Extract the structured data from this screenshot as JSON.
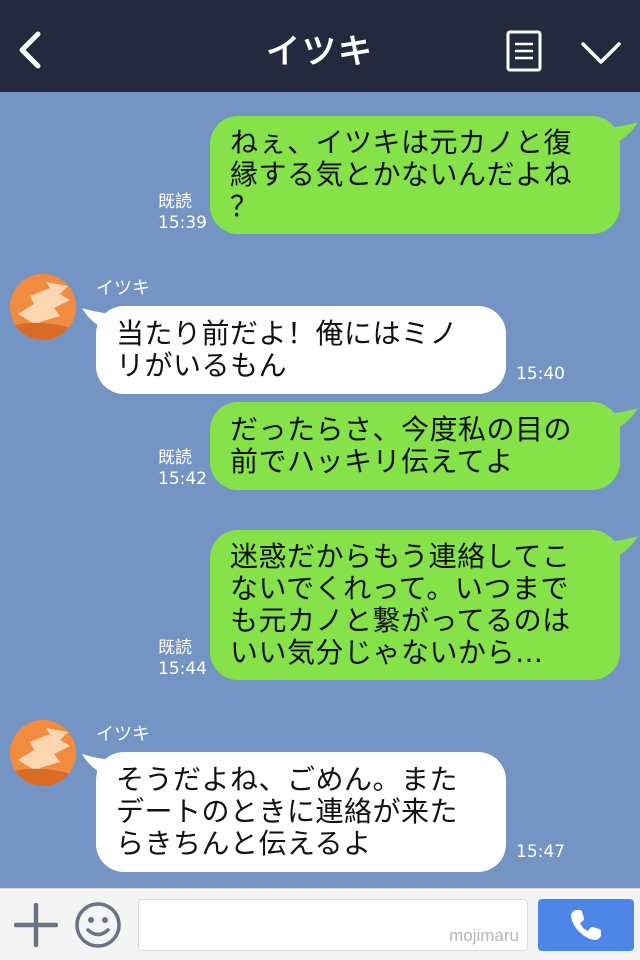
{
  "header": {
    "title": "イツキ"
  },
  "messages": [
    {
      "side": "right",
      "text": "ねぇ、イツキは元カノと復\n縁する気とかないんだよね\n？",
      "read": "既読",
      "time": "15:39"
    },
    {
      "side": "left",
      "sender": "イツキ",
      "text": "当たり前だよ！俺にはミノ\nリがいるもん",
      "time": "15:40"
    },
    {
      "side": "right",
      "text": "だったらさ、今度私の目の\n前でハッキリ伝えてよ",
      "read": "既読",
      "time": "15:42"
    },
    {
      "side": "right",
      "text": "迷惑だからもう連絡してこ\nないでくれって。いつまで\nも元カノと繋がってるのは\nいい気分じゃないから…",
      "read": "既読",
      "time": "15:44"
    },
    {
      "side": "left",
      "sender": "イツキ",
      "text": "そうだよね、ごめん。また\nデートのときに連絡が来た\nらきちんと伝えるよ",
      "time": "15:47"
    }
  ],
  "footer": {
    "input_value": "",
    "watermark": "mojimaru"
  },
  "icons": {
    "back": "back-icon",
    "menu": "menu-icon",
    "collapse": "chevron-down-icon",
    "plus": "plus-icon",
    "emoji": "emoji-icon",
    "call": "phone-icon"
  },
  "colors": {
    "header_bg": "#232a3d",
    "chat_bg": "#7494c4",
    "sent_bubble": "#85e249",
    "received_bubble": "#ffffff",
    "call_button": "#4e86e8"
  }
}
